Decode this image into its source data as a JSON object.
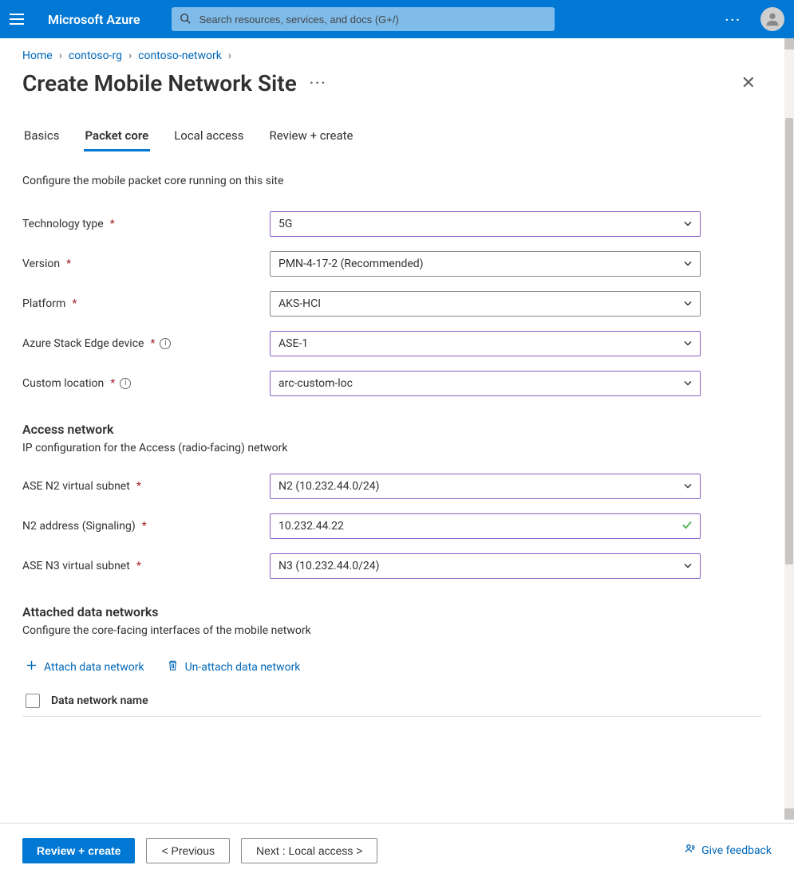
{
  "topbar": {
    "brand": "Microsoft Azure",
    "search_placeholder": "Search resources, services, and docs (G+/)"
  },
  "breadcrumb": {
    "items": [
      "Home",
      "contoso-rg",
      "contoso-network"
    ]
  },
  "page": {
    "title": "Create Mobile Network Site"
  },
  "tabs": [
    {
      "label": "Basics",
      "active": false
    },
    {
      "label": "Packet core",
      "active": true
    },
    {
      "label": "Local access",
      "active": false
    },
    {
      "label": "Review + create",
      "active": false
    }
  ],
  "intro": "Configure the mobile packet core running on this site",
  "fields": {
    "tech_type": {
      "label": "Technology type",
      "value": "5G"
    },
    "version": {
      "label": "Version",
      "value": "PMN-4-17-2 (Recommended)"
    },
    "platform": {
      "label": "Platform",
      "value": "AKS-HCI"
    },
    "ase_device": {
      "label": "Azure Stack Edge device",
      "value": "ASE-1"
    },
    "custom_loc": {
      "label": "Custom location",
      "value": "arc-custom-loc"
    }
  },
  "access_network": {
    "title": "Access network",
    "subtitle": "IP configuration for the Access (radio-facing) network",
    "n2_subnet": {
      "label": "ASE N2 virtual subnet",
      "value": "N2 (10.232.44.0/24)"
    },
    "n2_addr": {
      "label": "N2 address (Signaling)",
      "value": "10.232.44.22"
    },
    "n3_subnet": {
      "label": "ASE N3 virtual subnet",
      "value": "N3 (10.232.44.0/24)"
    }
  },
  "attached": {
    "title": "Attached data networks",
    "subtitle": "Configure the core-facing interfaces of the mobile network",
    "attach_label": "Attach data network",
    "unattach_label": "Un-attach data network",
    "col_label": "Data network name"
  },
  "footer": {
    "review": "Review + create",
    "prev": "< Previous",
    "next": "Next : Local access >",
    "feedback": "Give feedback"
  }
}
